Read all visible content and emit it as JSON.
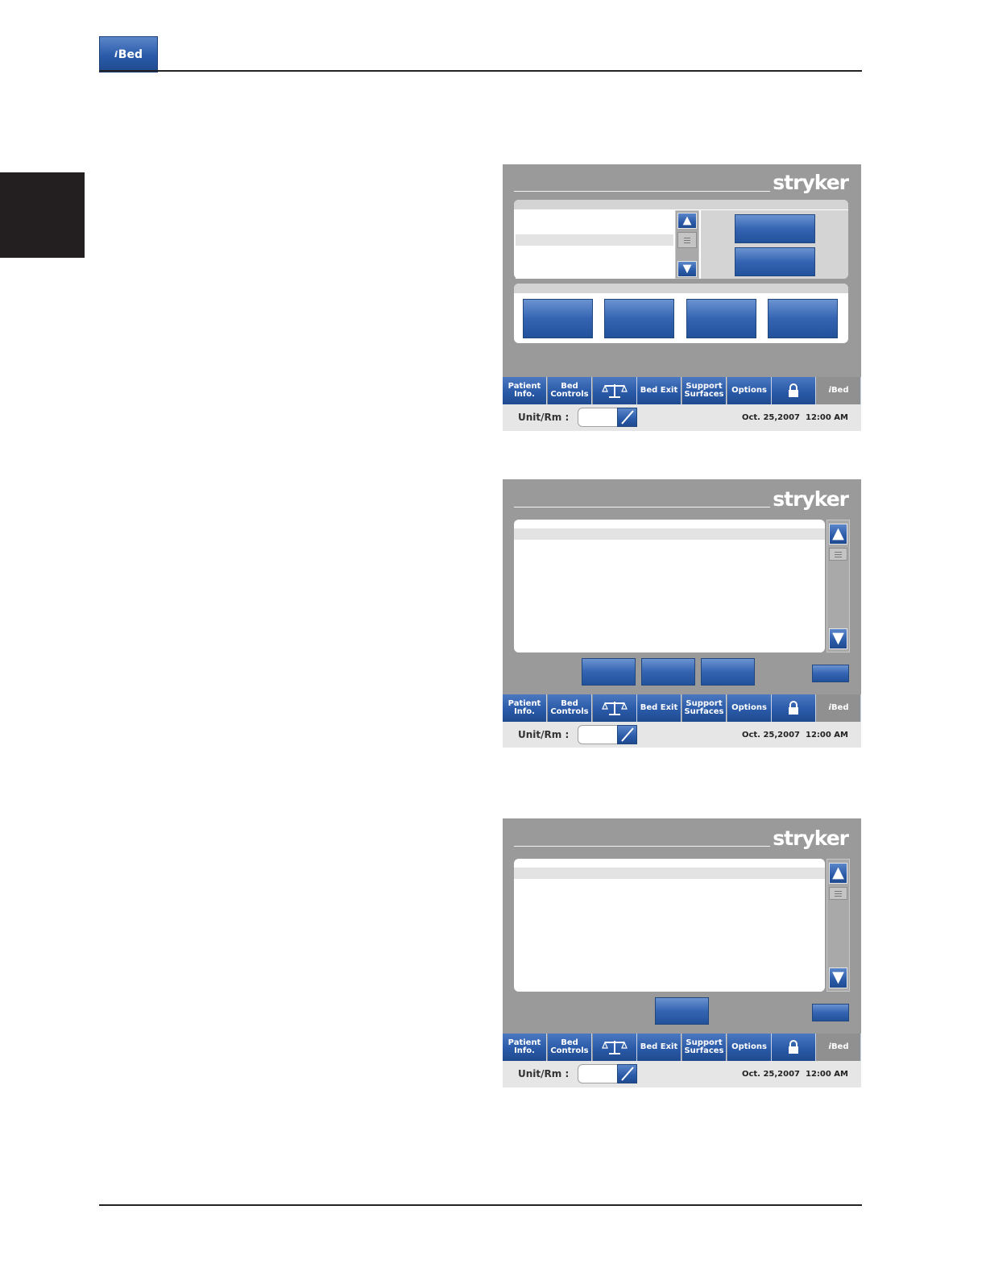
{
  "header": {
    "logo_text": "Bed",
    "logo_prefix": "i"
  },
  "screens": {
    "brand": "stryker",
    "nav": {
      "patient_info": [
        "Patient",
        "Info."
      ],
      "bed_controls": [
        "Bed",
        "Controls"
      ],
      "scale_icon": "scale-icon",
      "bed_exit": "Bed Exit",
      "support_surfaces": [
        "Support",
        "Surfaces"
      ],
      "options": "Options",
      "lock_icon": "lock-icon",
      "ibed": "Bed",
      "ibed_prefix": "i"
    },
    "status": {
      "unit_label": "Unit/Rm :",
      "unit_value": "",
      "date": "Oct. 25,2007",
      "time": "12:00 AM"
    }
  },
  "colors": {
    "accent": "#2a5aa8",
    "screen_bg": "#9a9a9a",
    "status_bg": "#e6e6e6"
  }
}
